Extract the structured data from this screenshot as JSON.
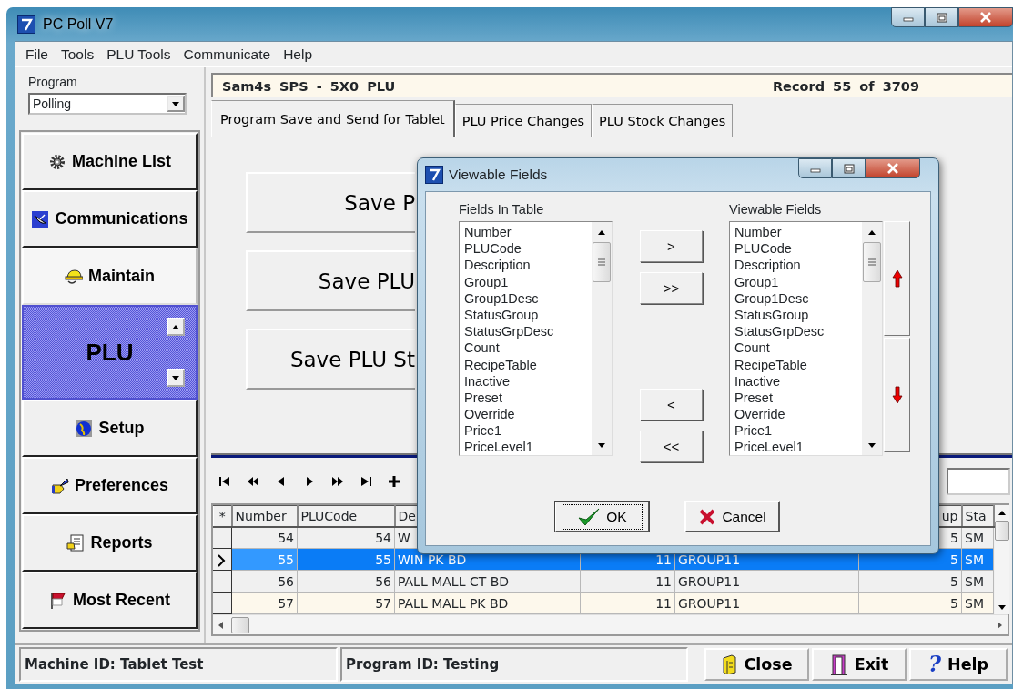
{
  "window": {
    "title": "PC Poll V7"
  },
  "menu": [
    {
      "label": "File"
    },
    {
      "label": "Tools"
    },
    {
      "label": "PLU Tools"
    },
    {
      "label": "Communicate"
    },
    {
      "label": "Help"
    }
  ],
  "program": {
    "label": "Program",
    "value": "Polling"
  },
  "sidebar": {
    "items": [
      {
        "label": "Machine List",
        "selected": false,
        "expanded": false
      },
      {
        "label": "Communications",
        "selected": false,
        "expanded": false
      },
      {
        "label": "Maintain",
        "selected": false,
        "expanded": true
      },
      {
        "label": "PLU",
        "selected": true,
        "expanded": false
      },
      {
        "label": "Setup",
        "selected": false,
        "expanded": false
      },
      {
        "label": "Preferences",
        "selected": false,
        "expanded": false
      },
      {
        "label": "Reports",
        "selected": false,
        "expanded": false
      },
      {
        "label": "Most Recent",
        "selected": false,
        "expanded": false
      }
    ]
  },
  "header": {
    "title": "Sam4s SPS - 5X0 PLU",
    "record": "Record 55 of 3709"
  },
  "tabs": [
    {
      "label": "Program Save and Send for Tablet",
      "selected": true
    },
    {
      "label": "PLU Price Changes",
      "selected": false
    },
    {
      "label": "PLU Stock Changes",
      "selected": false
    }
  ],
  "actions": [
    "Save P",
    "Save PLU",
    "Save PLU St"
  ],
  "grid": {
    "columns": [
      {
        "label": "*"
      },
      {
        "label": "Number"
      },
      {
        "label": "PLUCode"
      },
      {
        "label": "De"
      },
      {},
      {},
      {
        "label": "up"
      },
      {
        "label": "Sta"
      }
    ],
    "rows": [
      {
        "selected": false,
        "cells": [
          {},
          {
            "text": "54"
          },
          {
            "text": "54"
          },
          {
            "text": "W"
          },
          {},
          {},
          {
            "text": "5"
          },
          {
            "text": "SM"
          }
        ]
      },
      {
        "selected": true,
        "cells": [
          {},
          {
            "text": "55"
          },
          {
            "text": "55"
          },
          {
            "text": "WIN PK BD"
          },
          {
            "text": "11"
          },
          {
            "text": "GROUP11"
          },
          {
            "text": "5"
          },
          {
            "text": "SM"
          }
        ]
      },
      {
        "selected": false,
        "cells": [
          {},
          {
            "text": "56"
          },
          {
            "text": "56"
          },
          {
            "text": "PALL MALL CT BD"
          },
          {
            "text": "11"
          },
          {
            "text": "GROUP11"
          },
          {
            "text": "5"
          },
          {
            "text": "SM"
          }
        ]
      },
      {
        "selected": false,
        "cells": [
          {},
          {
            "text": "57"
          },
          {
            "text": "57"
          },
          {
            "text": "PALL MALL PK BD"
          },
          {
            "text": "11"
          },
          {
            "text": "GROUP11"
          },
          {
            "text": "5"
          },
          {
            "text": "SM"
          }
        ]
      }
    ]
  },
  "dialog": {
    "title": "Viewable Fields",
    "left": {
      "label": "Fields In Table",
      "items": [
        "Number",
        "PLUCode",
        "Description",
        "Group1",
        "Group1Desc",
        "StatusGroup",
        "StatusGrpDesc",
        "Count",
        "RecipeTable",
        "Inactive",
        "Preset",
        "Override",
        "Price1",
        "PriceLevel1"
      ]
    },
    "right": {
      "label": "Viewable Fields",
      "items": [
        "Number",
        "PLUCode",
        "Description",
        "Group1",
        "Group1Desc",
        "StatusGroup",
        "StatusGrpDesc",
        "Count",
        "RecipeTable",
        "Inactive",
        "Preset",
        "Override",
        "Price1",
        "PriceLevel1"
      ]
    },
    "add_buttons": [
      ">",
      ">>"
    ],
    "remove_buttons": [
      "<",
      "<<"
    ],
    "ok": "OK",
    "cancel": "Cancel"
  },
  "status_bar": {
    "machine": "Machine ID: Tablet Test",
    "program": "Program ID: Testing",
    "buttons": [
      {
        "kind": "close",
        "label": "Close"
      },
      {
        "kind": "exit",
        "label": "Exit"
      },
      {
        "kind": "help",
        "label": "Help",
        "icon": "?"
      }
    ]
  }
}
